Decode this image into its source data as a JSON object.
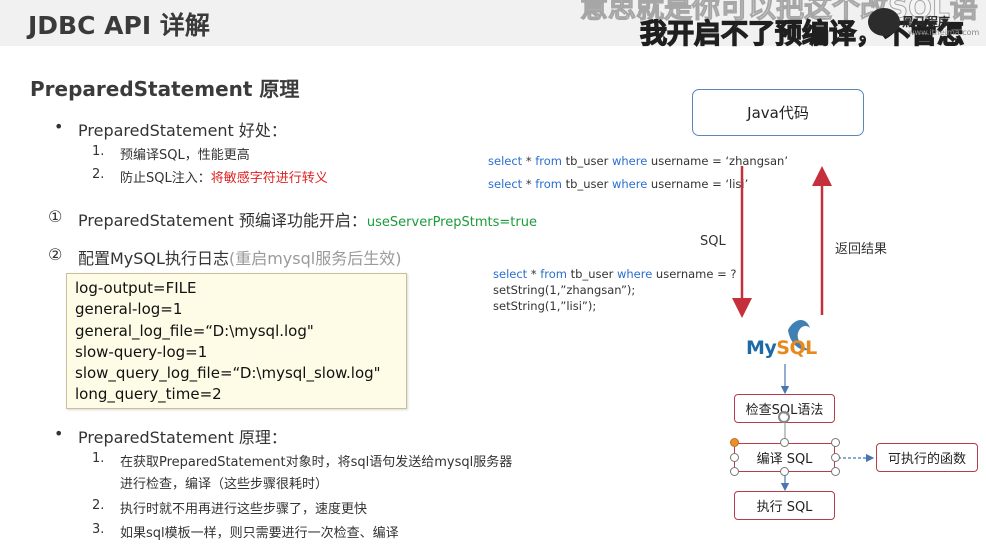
{
  "header": {
    "title": "JDBC API 详解",
    "subtitle_line1": "意思就是你可以把这个改SQL语",
    "subtitle_line2": "我开启不了预编译，不管怎",
    "logo_text": "黑马程序",
    "logo_url": "www.itheima.com"
  },
  "section": {
    "title": "PreparedStatement 原理"
  },
  "benefits": {
    "heading": "PreparedStatement 好处：",
    "items": [
      {
        "num": "1.",
        "text": "预编译SQL，性能更高"
      },
      {
        "num": "2.",
        "text": "防止SQL注入：",
        "highlight": "将敏感字符进行转义"
      }
    ]
  },
  "step1": {
    "marker": "①",
    "text": "PreparedStatement 预编译功能开启：",
    "param": "useServerPrepStmts=true"
  },
  "step2": {
    "marker": "②",
    "text": "配置MySQL执行日志",
    "note": "(重启mysql服务后生效)"
  },
  "config_lines": [
    "log-output=FILE",
    "general-log=1",
    "general_log_file=“D:\\mysql.log\"",
    "slow-query-log=1",
    "slow_query_log_file=“D:\\mysql_slow.log\"",
    "long_query_time=2"
  ],
  "principle": {
    "heading": "PreparedStatement 原理：",
    "items": [
      {
        "num": "1.",
        "text": "在获取PreparedStatement对象时，将sql语句发送给mysql服务器"
      },
      {
        "num": "",
        "text": "进行检查，编译（这些步骤很耗时）"
      },
      {
        "num": "2.",
        "text": "执行时就不用再进行这些步骤了，速度更快"
      },
      {
        "num": "3.",
        "text": "如果sql模板一样，则只需要进行一次检查、编译"
      }
    ]
  },
  "code_samples": {
    "query1": {
      "p1": "select",
      "p2": " * ",
      "p3": "from",
      "p4": " tb_user ",
      "p5": "where",
      "p6": " username = ‘zhangsan’"
    },
    "query2": {
      "p1": "select",
      "p2": " * ",
      "p3": "from",
      "p4": " tb_user ",
      "p5": "where",
      "p6": " username = ‘lisi’"
    },
    "template": {
      "p1": "select",
      "p2": " * ",
      "p3": "from",
      "p4": " tb_user ",
      "p5": "where",
      "p6": " username = ?"
    },
    "set1": "setString(1,”zhangsan”);",
    "set2": "setString(1,”lisi”);"
  },
  "diagram": {
    "java_label": "Java代码",
    "sql_label": "SQL",
    "return_label": "返回结果",
    "mysql_my": "My",
    "mysql_sql": "SQL",
    "check_label": "检查SQL语法",
    "compile_label": "编译 SQL",
    "exec_label": "执行 SQL",
    "func_label": "可执行的函数"
  }
}
